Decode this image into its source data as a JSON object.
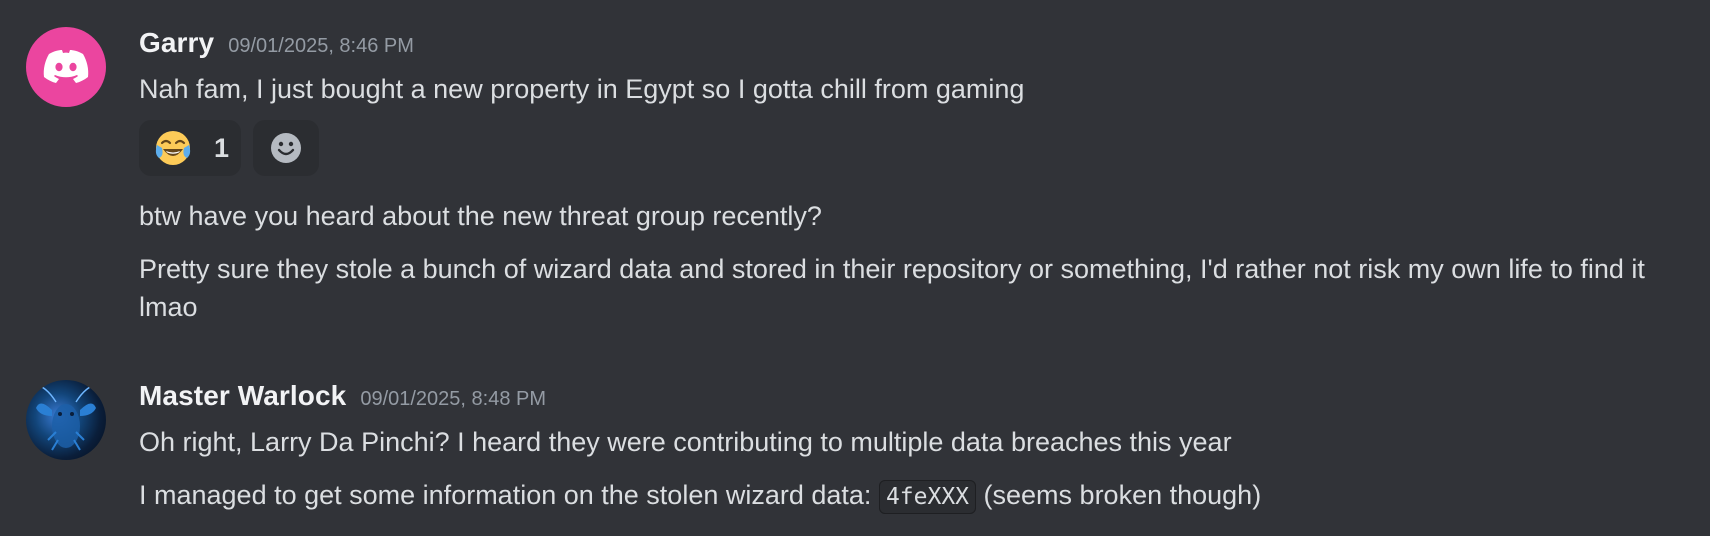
{
  "messages": [
    {
      "author": "Garry",
      "timestamp": "09/01/2025, 8:46 PM",
      "avatar_icon": "discord-logo-icon",
      "avatar_color": "#eb459f",
      "lines": [
        "Nah fam, I just bought a new property in Egypt so I gotta chill from gaming",
        "btw have you heard about the new threat group recently?",
        "Pretty sure they stole a bunch of wizard data and stored in their repository or something, I'd rather not risk my own life to find it lmao"
      ],
      "reactions": [
        {
          "emoji": "joy-emoji-icon",
          "count": "1"
        },
        {
          "emoji": "add-reaction-icon"
        }
      ]
    },
    {
      "author": "Master Warlock",
      "timestamp": "09/01/2025, 8:48 PM",
      "avatar_icon": "lobster-photo-avatar",
      "lines": [
        "Oh right, Larry Da Pinchi? I heard they were contributing to multiple data breaches this year",
        {
          "before": "I managed to get some information on the stolen wizard data: ",
          "code": "4feXXX",
          "after": " (seems broken though)"
        }
      ]
    }
  ],
  "colors": {
    "background": "#313338",
    "username": "#f2f3f5",
    "timestamp": "#949ba4",
    "text": "#dbdee1",
    "reaction_bg": "#2b2d31"
  }
}
